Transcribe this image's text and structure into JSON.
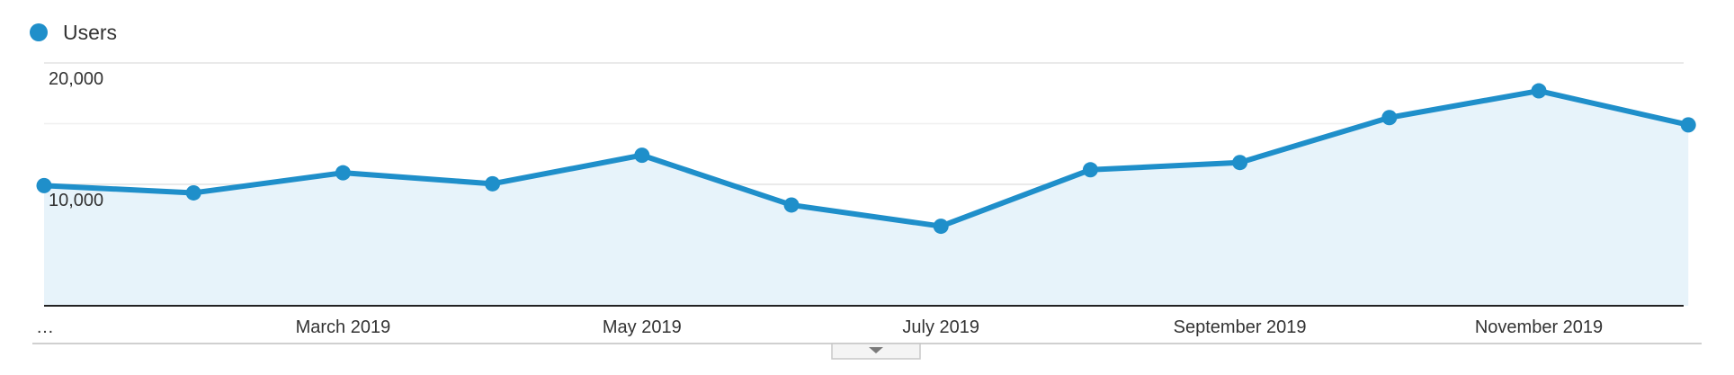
{
  "legend": {
    "label": "Users",
    "dot_color": "#1f8fca"
  },
  "colors": {
    "line": "#1f8fca",
    "area_fill": "#e7f3fa",
    "grid": "#e8e8e8",
    "baseline": "#222222",
    "tick_text": "#333333"
  },
  "chart_data": {
    "type": "area",
    "title": "",
    "xlabel": "",
    "ylabel": "",
    "x": [
      "2019-01-01",
      "2019-02-01",
      "2019-03-01",
      "2019-04-01",
      "2019-05-01",
      "2019-06-01",
      "2019-07-01",
      "2019-08-01",
      "2019-09-01",
      "2019-10-01",
      "2019-11-01",
      "2019-12-01"
    ],
    "series": [
      {
        "name": "Users",
        "values": [
          9900,
          9300,
          10950,
          10050,
          12400,
          8300,
          6550,
          11200,
          11800,
          15500,
          17700,
          14900
        ]
      }
    ],
    "ylim": [
      0,
      20000
    ],
    "y_ticks": [
      {
        "value": 20000,
        "label": "20,000"
      },
      {
        "value": 10000,
        "label": "10,000"
      }
    ],
    "y_minor_gridlines": [
      5000,
      15000
    ],
    "x_tick_labels": [
      {
        "x": "2019-01-01",
        "label": "…"
      },
      {
        "x": "2019-03-01",
        "label": "March 2019"
      },
      {
        "x": "2019-05-01",
        "label": "May 2019"
      },
      {
        "x": "2019-07-01",
        "label": "July 2019"
      },
      {
        "x": "2019-09-01",
        "label": "September 2019"
      },
      {
        "x": "2019-11-01",
        "label": "November 2019"
      }
    ],
    "grid": true,
    "legend_position": "top-left"
  },
  "toggle": {
    "icon": "caret-down-icon"
  }
}
